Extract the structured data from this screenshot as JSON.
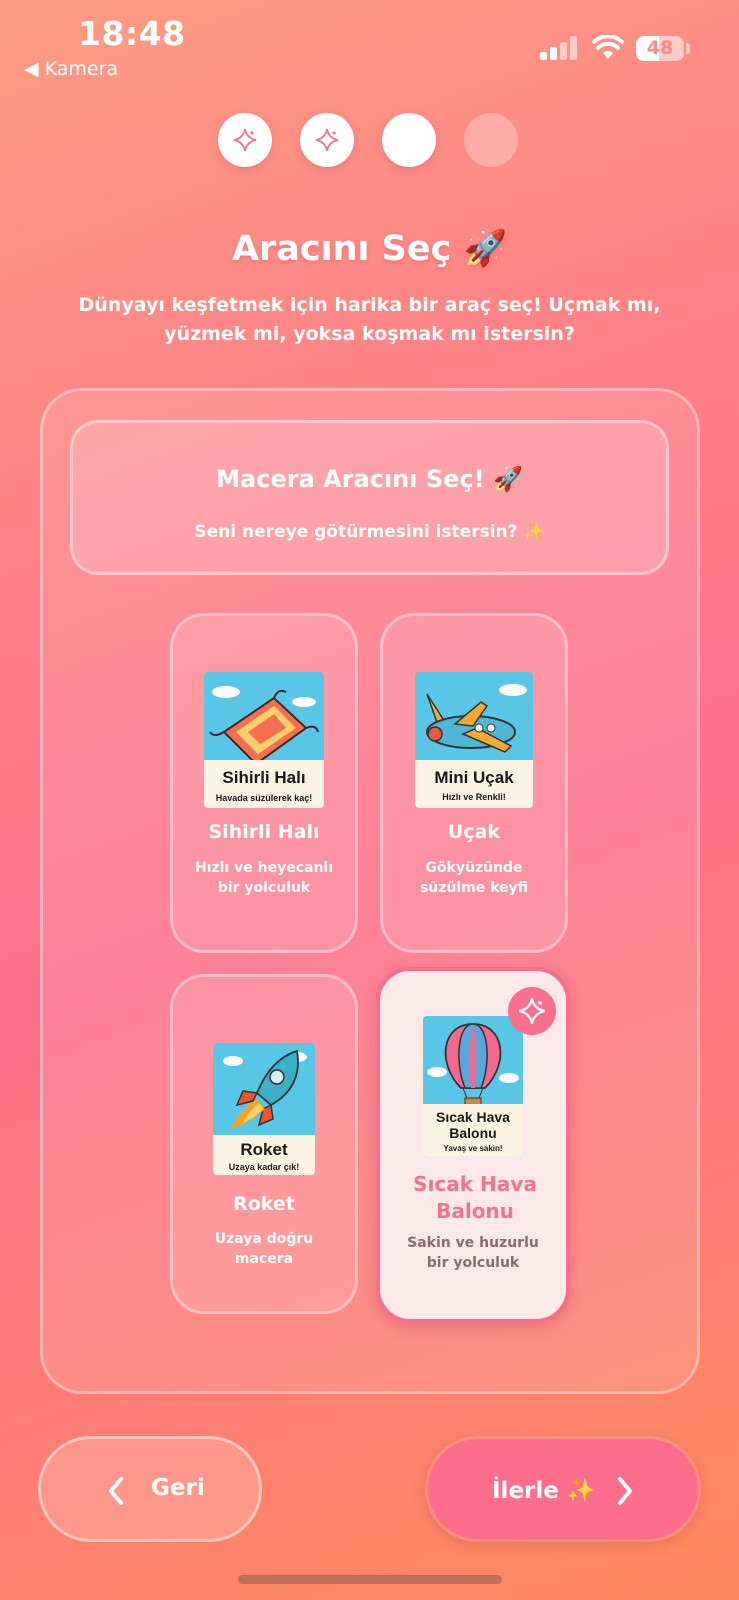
{
  "status": {
    "time": "18:48",
    "back_label": "◀ Kamera",
    "battery": "48",
    "battery_level": 0.48
  },
  "stepper": {
    "total": 4,
    "current": 3,
    "completed_icon": "sparkle-icon"
  },
  "title": "Aracını Seç 🚀",
  "subtitle": "Dünyayı keşfetmek için harika bir araç seç! Uçmak mı, yüzmek mi, yoksa koşmak mı istersin?",
  "header_card": {
    "title": "Macera Aracını Seç! 🚀",
    "subtitle": "Seni nereye götürmesini istersin? ✨"
  },
  "vehicles": [
    {
      "name": "Sihirli Halı",
      "desc": "Hızlı ve heyecanlı bir yolculuk",
      "img_title": "Sihirli Halı",
      "img_sub": "Havada süzülerek kaç!",
      "selected": false
    },
    {
      "name": "Uçak",
      "desc": "Gökyüzünde süzülme keyfi",
      "img_title": "Mini Uçak",
      "img_sub": "Hızlı ve Renkli!",
      "selected": false
    },
    {
      "name": "Roket",
      "desc": "Uzaya doğru macera",
      "img_title": "Roket",
      "img_sub": "Uzaya kadar çık!",
      "selected": false
    },
    {
      "name": "Sıcak Hava Balonu",
      "desc": "Sakin ve huzurlu bir yolculuk",
      "img_title": "Sıcak Hava Balonu",
      "img_sub": "Yavaş ve sakin!",
      "selected": true
    }
  ],
  "buttons": {
    "back": "Geri",
    "next": "İlerle ✨"
  },
  "colors": {
    "accent": "#f7708d",
    "selected_bg": "#fbe9ea"
  }
}
